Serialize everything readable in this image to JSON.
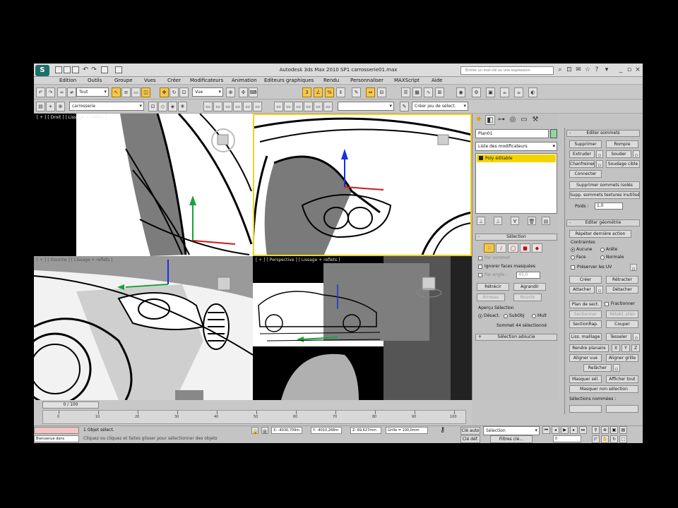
{
  "window": {
    "title": "Autodesk 3ds Max  2010 SP1       carrosserie01.max",
    "search_placeholder": "Entrez un mot-clé ou une expression",
    "logo_text": "S"
  },
  "menu": [
    "Edition",
    "Outils",
    "Groupe",
    "Vues",
    "Créer",
    "Modificateurs",
    "Animation",
    "Editeurs graphiques",
    "Rendu",
    "Personnaliser",
    "MAXScript",
    "Aide"
  ],
  "toolbar": {
    "selection_filter": "Tout",
    "coord_system": "Vue",
    "named_selection": "Créer jeu de sélect.",
    "layer": "carrosserie"
  },
  "viewports": {
    "top_left_label": "[ + ] [ Droit ] [ Lissage + reflets ]",
    "bottom_left_label": "[ + ] [ Gauche ] [ Lissage + reflets ]",
    "bottom_right_label": "[ + ] [ Perspective ] [ Lissage + reflets ]",
    "gizmo_y": "y"
  },
  "command_panel": {
    "object_name": "Plan01",
    "object_color": "#8fd6a0",
    "modifier_list": "Liste des modificateurs",
    "stack_item": "Poly éditable",
    "selection_header": "Sélection",
    "by_vertex": "Par sommet",
    "ignore_backfacing": "Ignorer faces masquées",
    "by_angle": "Par angle :",
    "by_angle_value": "45,0",
    "shrink": "Rétrécir",
    "grow": "Agrandir",
    "ring": "Anneau",
    "loop": "Boucle",
    "preview_label": "Aperçu Sélection",
    "preview_off": "Désact.",
    "preview_subobj": "SubObj",
    "preview_multi": "Mult",
    "selected_count": "Sommet 44 sélectionné",
    "soft_selection": "Sélection adoucie"
  },
  "edit_panel": {
    "edit_vertices": "Editer sommets",
    "remove": "Supprimer",
    "break": "Rompre",
    "extrude": "Extruder",
    "weld": "Souder",
    "chamfer": "Chanfreiner",
    "target_weld": "Soudage cible",
    "connect": "Connecter",
    "remove_isolated": "Supprimer sommets isolés",
    "remove_unused": "Supp. sommets textures inutilisés",
    "weight_label": "Poids :",
    "weight_value": "1,0",
    "edit_geometry": "Editer géométrie",
    "repeat_last": "Répéter dernière action",
    "constraints": "Contraintes",
    "c_none": "Aucune",
    "c_edge": "Arête",
    "c_face": "Face",
    "c_normal": "Normale",
    "preserve_uv": "Préserver les UV",
    "create": "Créer",
    "collapse": "Rétracter",
    "attach": "Attacher",
    "detach": "Détacher",
    "slice_plane": "Plan de sect.",
    "split": "Fractionner",
    "slice": "Sectionner",
    "reset_plane": "Rétabl. plan",
    "quickslice": "SectionRap.",
    "cut": "Couper",
    "msmooth": "Liss. maillage",
    "tessellate": "Tesseler",
    "make_planar": "Rendre planaire",
    "x": "X",
    "y": "Y",
    "z": "Z",
    "view_align": "Aligner vue",
    "grid_align": "Aligner grille",
    "relax": "Relâcher",
    "hide_sel": "Masquer sél.",
    "unhide_all": "Afficher tout",
    "hide_unsel": "Masquer non sélection",
    "named_sel": "Sélections nommées :"
  },
  "timeline": {
    "frame": "0 / 100",
    "ticks": [
      "0",
      "10",
      "20",
      "30",
      "40",
      "50",
      "60",
      "70",
      "80",
      "90",
      "100"
    ]
  },
  "status": {
    "object_selected": "1 Objet sélect.",
    "prompt": "Cliquez ou cliquez et faites glisser pour sélectionner des objets",
    "maxscript": "Bienvenue dans",
    "x": "X: -4030,709m",
    "y": "Y: -4010,268m",
    "z": "Z: 69,627mm",
    "grid": "Grille = 100,0mm",
    "autokey": "Clé auto",
    "selection_mode": "Sélection",
    "set_key": "Clé déf.",
    "key_filters": "Filtres clé...",
    "add_time_tag": "Ajout. Etiq.Heure",
    "frame_field": "0"
  },
  "colors": {
    "accent_yellow": "#f1d21b",
    "gizmo_blue": "#1a2fd6",
    "gizmo_green": "#19a23a",
    "gizmo_red": "#d21a1a"
  }
}
